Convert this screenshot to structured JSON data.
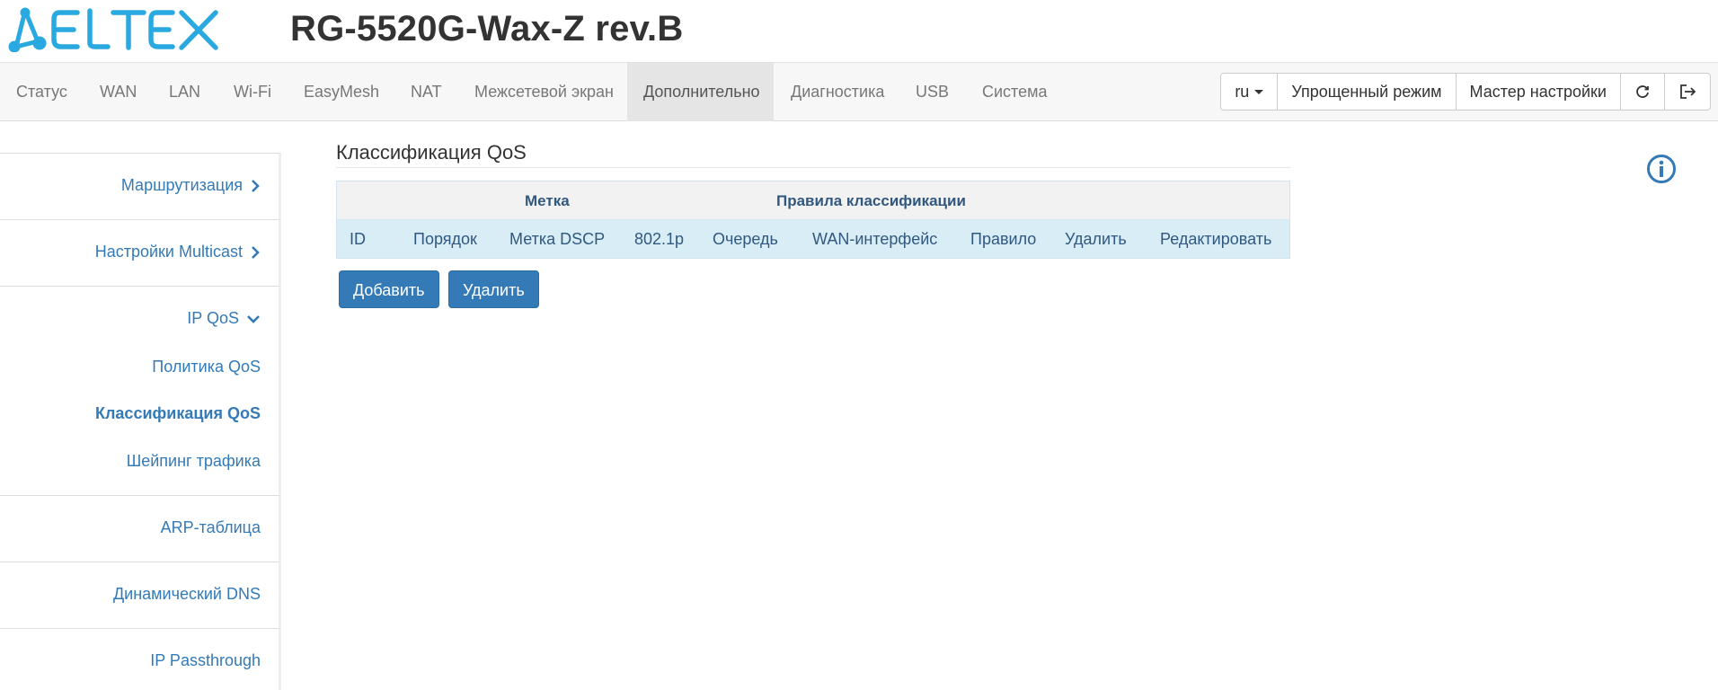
{
  "brand": {
    "logo_text": "ELTEX",
    "device_title": "RG-5520G-Wax-Z rev.B"
  },
  "navbar": {
    "items": [
      {
        "label": "Статус"
      },
      {
        "label": "WAN"
      },
      {
        "label": "LAN"
      },
      {
        "label": "Wi-Fi"
      },
      {
        "label": "EasyMesh"
      },
      {
        "label": "NAT"
      },
      {
        "label": "Межсетевой экран"
      },
      {
        "label": "Дополнительно",
        "active": true
      },
      {
        "label": "Диагностика"
      },
      {
        "label": "USB"
      },
      {
        "label": "Система"
      }
    ],
    "language": "ru",
    "simple_mode_label": "Упрощенный режим",
    "wizard_label": "Мастер настройки",
    "refresh_icon": "refresh-icon",
    "logout_icon": "logout-icon"
  },
  "sidebar": {
    "items": [
      {
        "label": "Маршрутизация",
        "icon": "chevron-right-icon"
      },
      {
        "label": "Настройки Multicast",
        "icon": "chevron-right-icon"
      },
      {
        "label": "IP QoS",
        "icon": "chevron-down-icon"
      },
      {
        "label": "Политика QoS"
      },
      {
        "label": "Классификация QoS",
        "active": true
      },
      {
        "label": "Шейпинг трафика"
      },
      {
        "label": "ARP-таблица"
      },
      {
        "label": "Динамический DNS"
      },
      {
        "label": "IP Passthrough"
      }
    ]
  },
  "main": {
    "title": "Классификация QoS",
    "info_icon": "info-icon",
    "table": {
      "group_headers": [
        "Метка",
        "Правила классификации"
      ],
      "columns": [
        "ID",
        "Порядок",
        "Метка DSCP",
        "802.1p",
        "Очередь",
        "WAN-интерфейс",
        "Правило",
        "Удалить",
        "Редактировать"
      ],
      "rows": []
    },
    "buttons": {
      "add": "Добавить",
      "delete": "Удалить"
    }
  },
  "colors": {
    "link": "#337ab7",
    "button": "#337ab7",
    "table_head": "#d9edf7",
    "header_text": "#31587e"
  }
}
